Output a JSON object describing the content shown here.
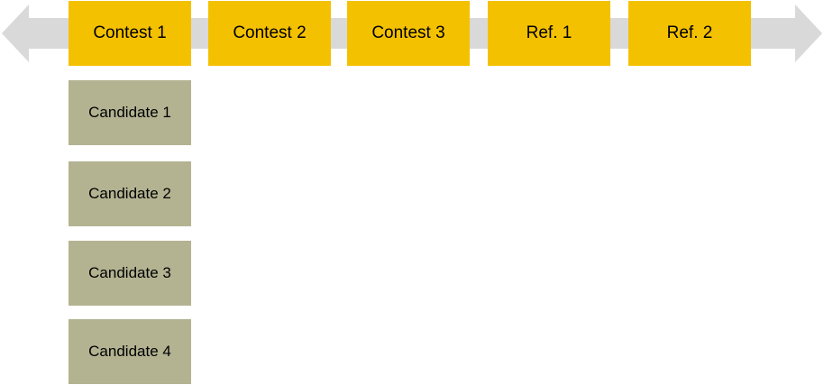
{
  "colors": {
    "arrow": "#d9d9d9",
    "contest_fill": "#f4c100",
    "candidate_fill": "#b3b392",
    "text": "#000000"
  },
  "timeline": {
    "items": [
      {
        "label": "Contest 1"
      },
      {
        "label": "Contest 2"
      },
      {
        "label": "Contest 3"
      },
      {
        "label": "Ref. 1"
      },
      {
        "label": "Ref. 2"
      }
    ]
  },
  "candidates": {
    "items": [
      {
        "label": "Candidate 1"
      },
      {
        "label": "Candidate 2"
      },
      {
        "label": "Candidate 3"
      },
      {
        "label": "Candidate 4"
      }
    ]
  }
}
